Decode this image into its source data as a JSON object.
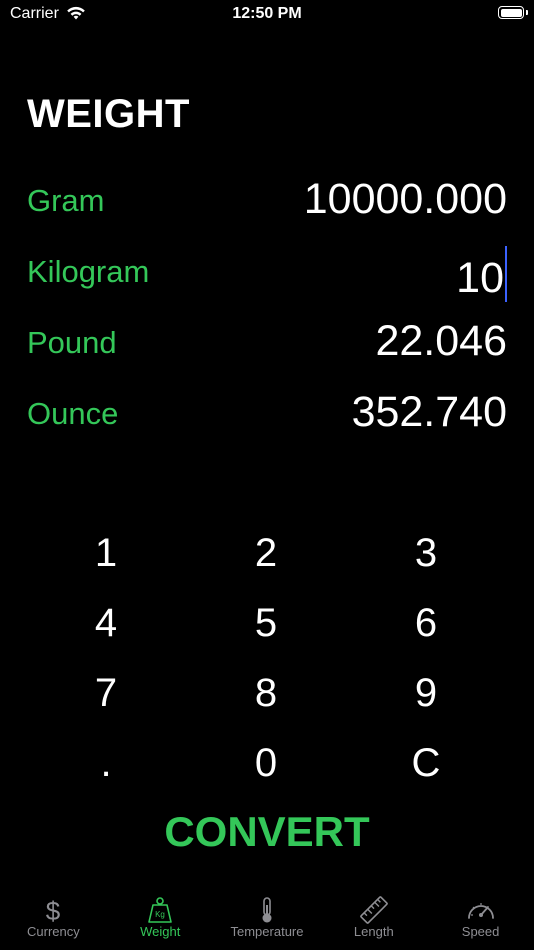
{
  "status_bar": {
    "carrier": "Carrier",
    "time": "12:50 PM"
  },
  "title": "WEIGHT",
  "units": [
    {
      "label": "Gram",
      "value": "10000.000"
    },
    {
      "label": "Kilogram",
      "value": "10"
    },
    {
      "label": "Pound",
      "value": "22.046"
    },
    {
      "label": "Ounce",
      "value": "352.740"
    }
  ],
  "keypad": [
    [
      "1",
      "2",
      "3"
    ],
    [
      "4",
      "5",
      "6"
    ],
    [
      "7",
      "8",
      "9"
    ],
    [
      ".",
      "0",
      "C"
    ]
  ],
  "convert_label": "CONVERT",
  "tabs": [
    {
      "label": "Currency",
      "icon": "dollar-icon",
      "active": false
    },
    {
      "label": "Weight",
      "icon": "kg-weight-icon",
      "active": true
    },
    {
      "label": "Temperature",
      "icon": "thermometer-icon",
      "active": false
    },
    {
      "label": "Length",
      "icon": "ruler-icon",
      "active": false
    },
    {
      "label": "Speed",
      "icon": "speedometer-icon",
      "active": false
    }
  ],
  "colors": {
    "accent": "#34c759",
    "caret": "#3b62ff",
    "inactive": "#8e8e93",
    "background": "#000000"
  }
}
